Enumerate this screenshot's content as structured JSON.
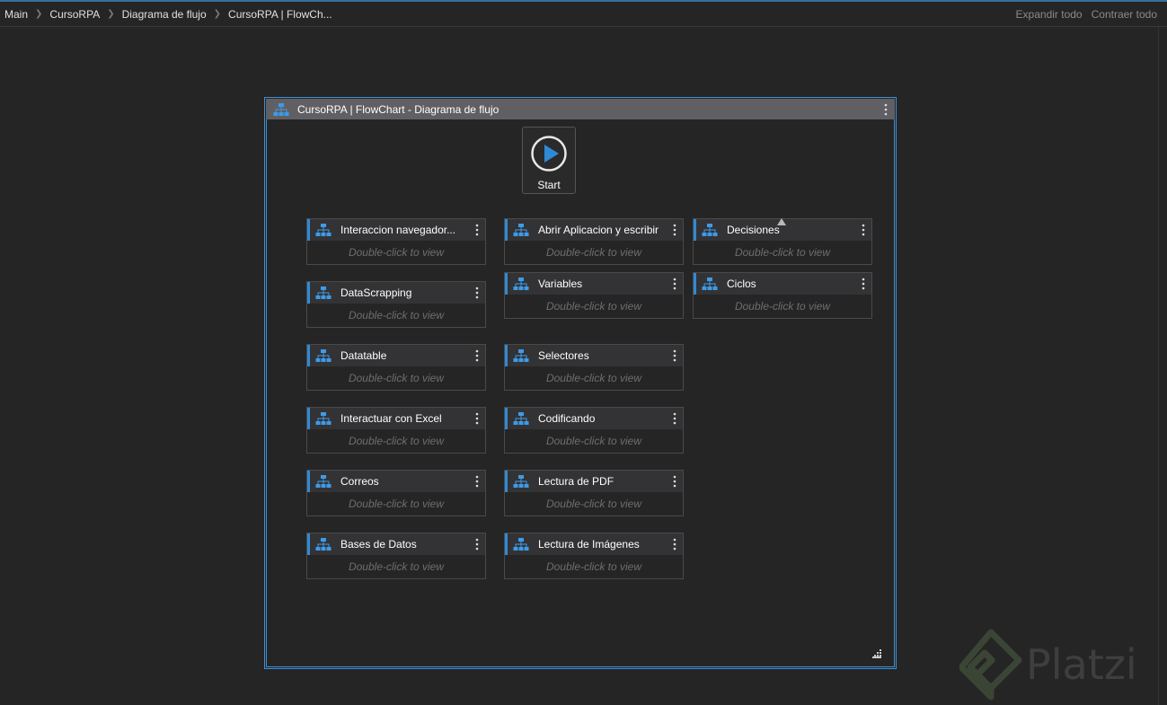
{
  "breadcrumb": {
    "items": [
      "Main",
      "CursoRPA",
      "Diagrama de flujo",
      "CursoRPA | FlowCh..."
    ],
    "expand_all": "Expandir todo",
    "collapse_all": "Contraer todo"
  },
  "flowchart": {
    "title": "CursoRPA | FlowChart - Diagrama de flujo",
    "start_label": "Start",
    "hint": "Double-click to view",
    "activities": [
      "Interaccion navegador...",
      "DataScrapping",
      "Datatable",
      "Interactuar con Excel",
      "Correos",
      "Bases de Datos",
      "Abrir Aplicacion y escribir",
      "Variables",
      "Selectores",
      "Codificando",
      "Lectura de PDF",
      "Lectura de Imágenes",
      "Decisiones",
      "Ciclos"
    ]
  },
  "watermark": {
    "text": "Platzi"
  },
  "colors": {
    "accent": "#3d8fd6",
    "header": "#606064",
    "background": "#252526"
  }
}
